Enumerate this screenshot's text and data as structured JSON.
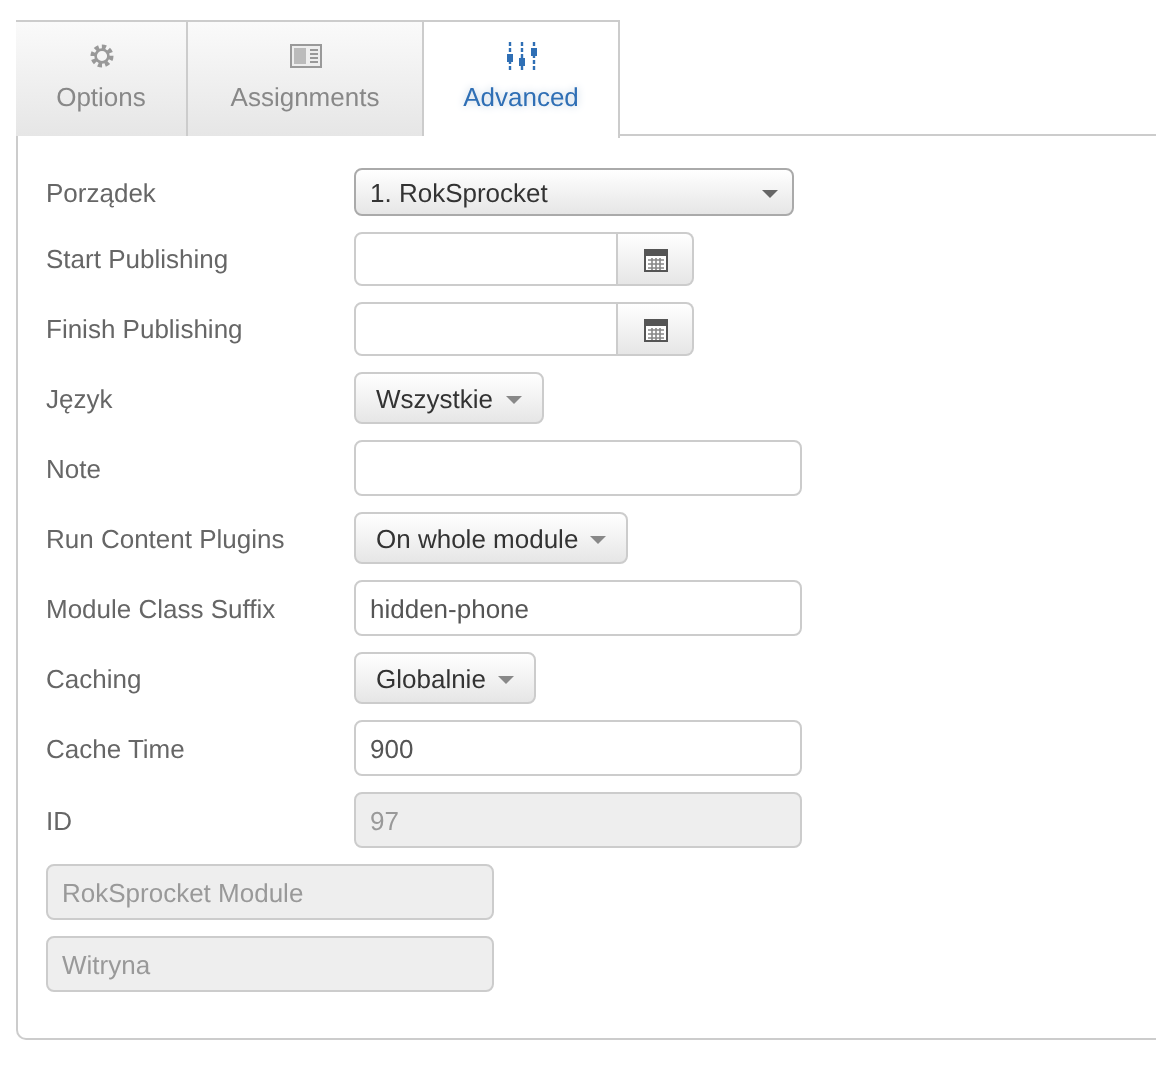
{
  "tabs": [
    {
      "label": "Options",
      "kind": "gear",
      "selected": false
    },
    {
      "label": "Assignments",
      "kind": "layout",
      "selected": false
    },
    {
      "label": "Advanced",
      "kind": "sliders",
      "selected": true
    }
  ],
  "fields": [
    {
      "kind": "select",
      "label": "Porządek",
      "value": "1. RokSprocket"
    },
    {
      "kind": "date",
      "label": "Start Publishing"
    },
    {
      "kind": "date",
      "label": "Finish Publishing"
    },
    {
      "kind": "dropdown",
      "label": "Język",
      "value": "Wszystkie"
    },
    {
      "kind": "text",
      "label": "Note"
    },
    {
      "kind": "dropdown",
      "label": "Run Content Plugins",
      "value": "On whole module"
    },
    {
      "kind": "text",
      "label": "Module Class Suffix",
      "value": "hidden-phone"
    },
    {
      "kind": "dropdown",
      "label": "Caching",
      "value": "Globalnie"
    },
    {
      "kind": "text",
      "label": "Cache Time",
      "value": "900"
    },
    {
      "kind": "readonly",
      "label": "ID",
      "value": "97"
    },
    {
      "kind": "readonly-wide",
      "value": "RokSprocket Module"
    },
    {
      "kind": "readonly-wide",
      "value": "Witryna"
    }
  ]
}
